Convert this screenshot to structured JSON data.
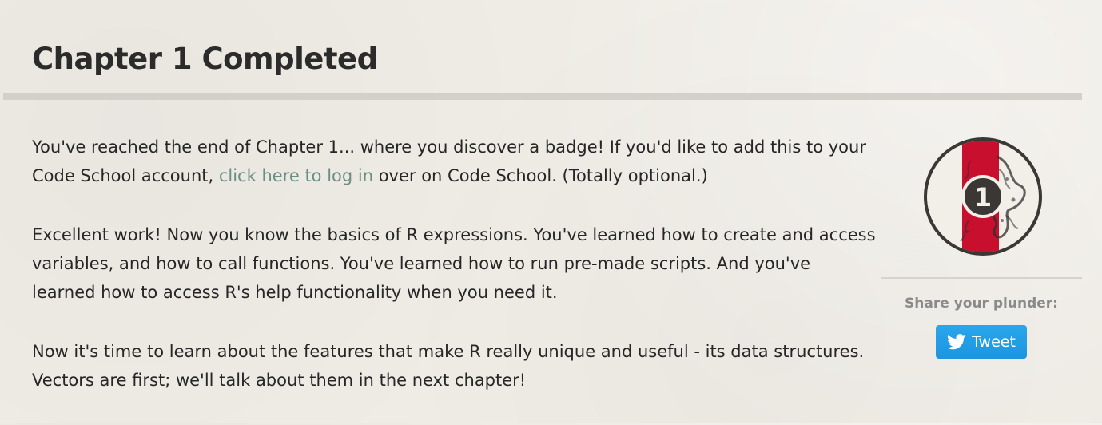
{
  "header": {
    "title": "Chapter 1 Completed"
  },
  "main": {
    "intro": {
      "before_link": "You've reached the end of Chapter 1... where you discover a badge! If you'd like to add this to your Code School account, ",
      "link_text": "click here to log in",
      "after_link": " over on Code School. (Totally optional.)"
    },
    "paragraph2": "Excellent work! Now you know the basics of R expressions. You've learned how to create and access variables, and how to call functions. You've learned how to run pre-made scripts. And you've learned how to access R's help functionality when you need it.",
    "paragraph3": "Now it's time to learn about the features that make R really unique and useful - its data structures. Vectors are first; we'll talk about them in the next chapter!"
  },
  "sidebar": {
    "badge_number": "1",
    "share_label": "Share your plunder:",
    "tweet_label": "Tweet",
    "tweet_icon": "twitter-bird-icon"
  },
  "colors": {
    "link": "#6a8e86",
    "badge_red": "#c8102e",
    "badge_ring": "#3a3734",
    "tweet_blue": "#1da1f2",
    "rule": "#d3d0ca"
  }
}
